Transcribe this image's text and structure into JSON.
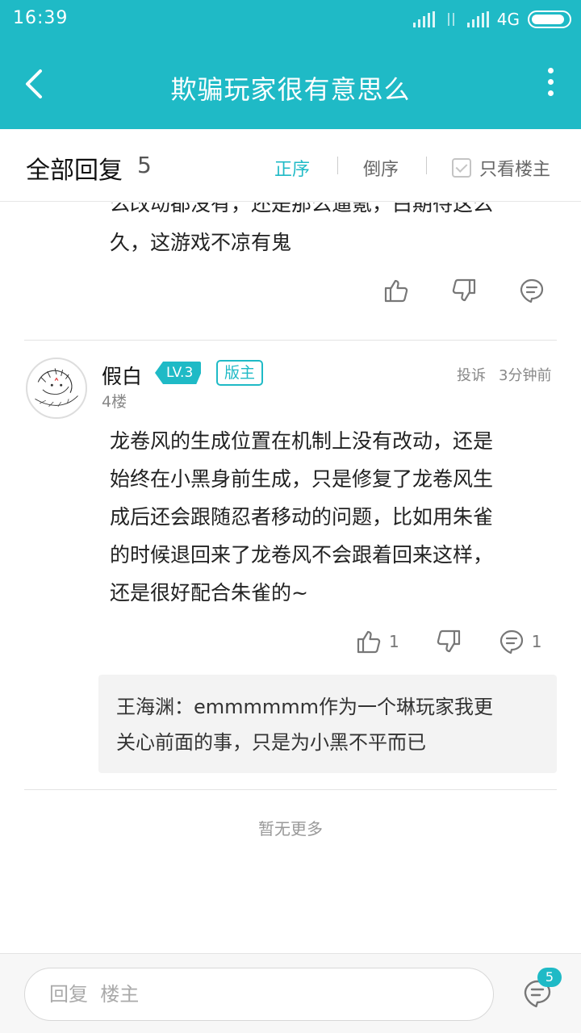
{
  "status_bar": {
    "time": "16:39",
    "network": "4G"
  },
  "header": {
    "title": "欺骗玩家很有意思么",
    "back_icon": "chevron-left-icon",
    "more_icon": "more-vertical-icon"
  },
  "sort_bar": {
    "all_replies_label": "全部回复",
    "reply_count": "5",
    "order_asc": "正序",
    "order_desc": "倒序",
    "only_owner": "只看楼主",
    "accent_color": "#1fbac6"
  },
  "previous_post": {
    "text_line1": "么改动都没有，还是那么逼氪，白期待这么",
    "text_line2": "久，这游戏不凉有鬼"
  },
  "post": {
    "username": "假白",
    "level": "LV.3",
    "role_badge": "版主",
    "floor": "4楼",
    "report": "投诉",
    "time_ago": "3分钟前",
    "lines": [
      "龙卷风的生成位置在机制上没有改动，还是",
      "始终在小黑身前生成，只是修复了龙卷风生",
      "成后还会跟随忍者移动的问题，比如用朱雀",
      "的时候退回来了龙卷风不会跟着回来这样，",
      "还是很好配合朱雀的~"
    ],
    "like_count": "1",
    "comment_count": "1",
    "quote_line1": "王海渊：emmmmmm作为一个琳玩家我更",
    "quote_line2": "关心前面的事，只是为小黑不平而已"
  },
  "footer": {
    "no_more": "暂无更多"
  },
  "bottom_bar": {
    "reply_placeholder": "回复  楼主",
    "comment_badge": "5"
  }
}
